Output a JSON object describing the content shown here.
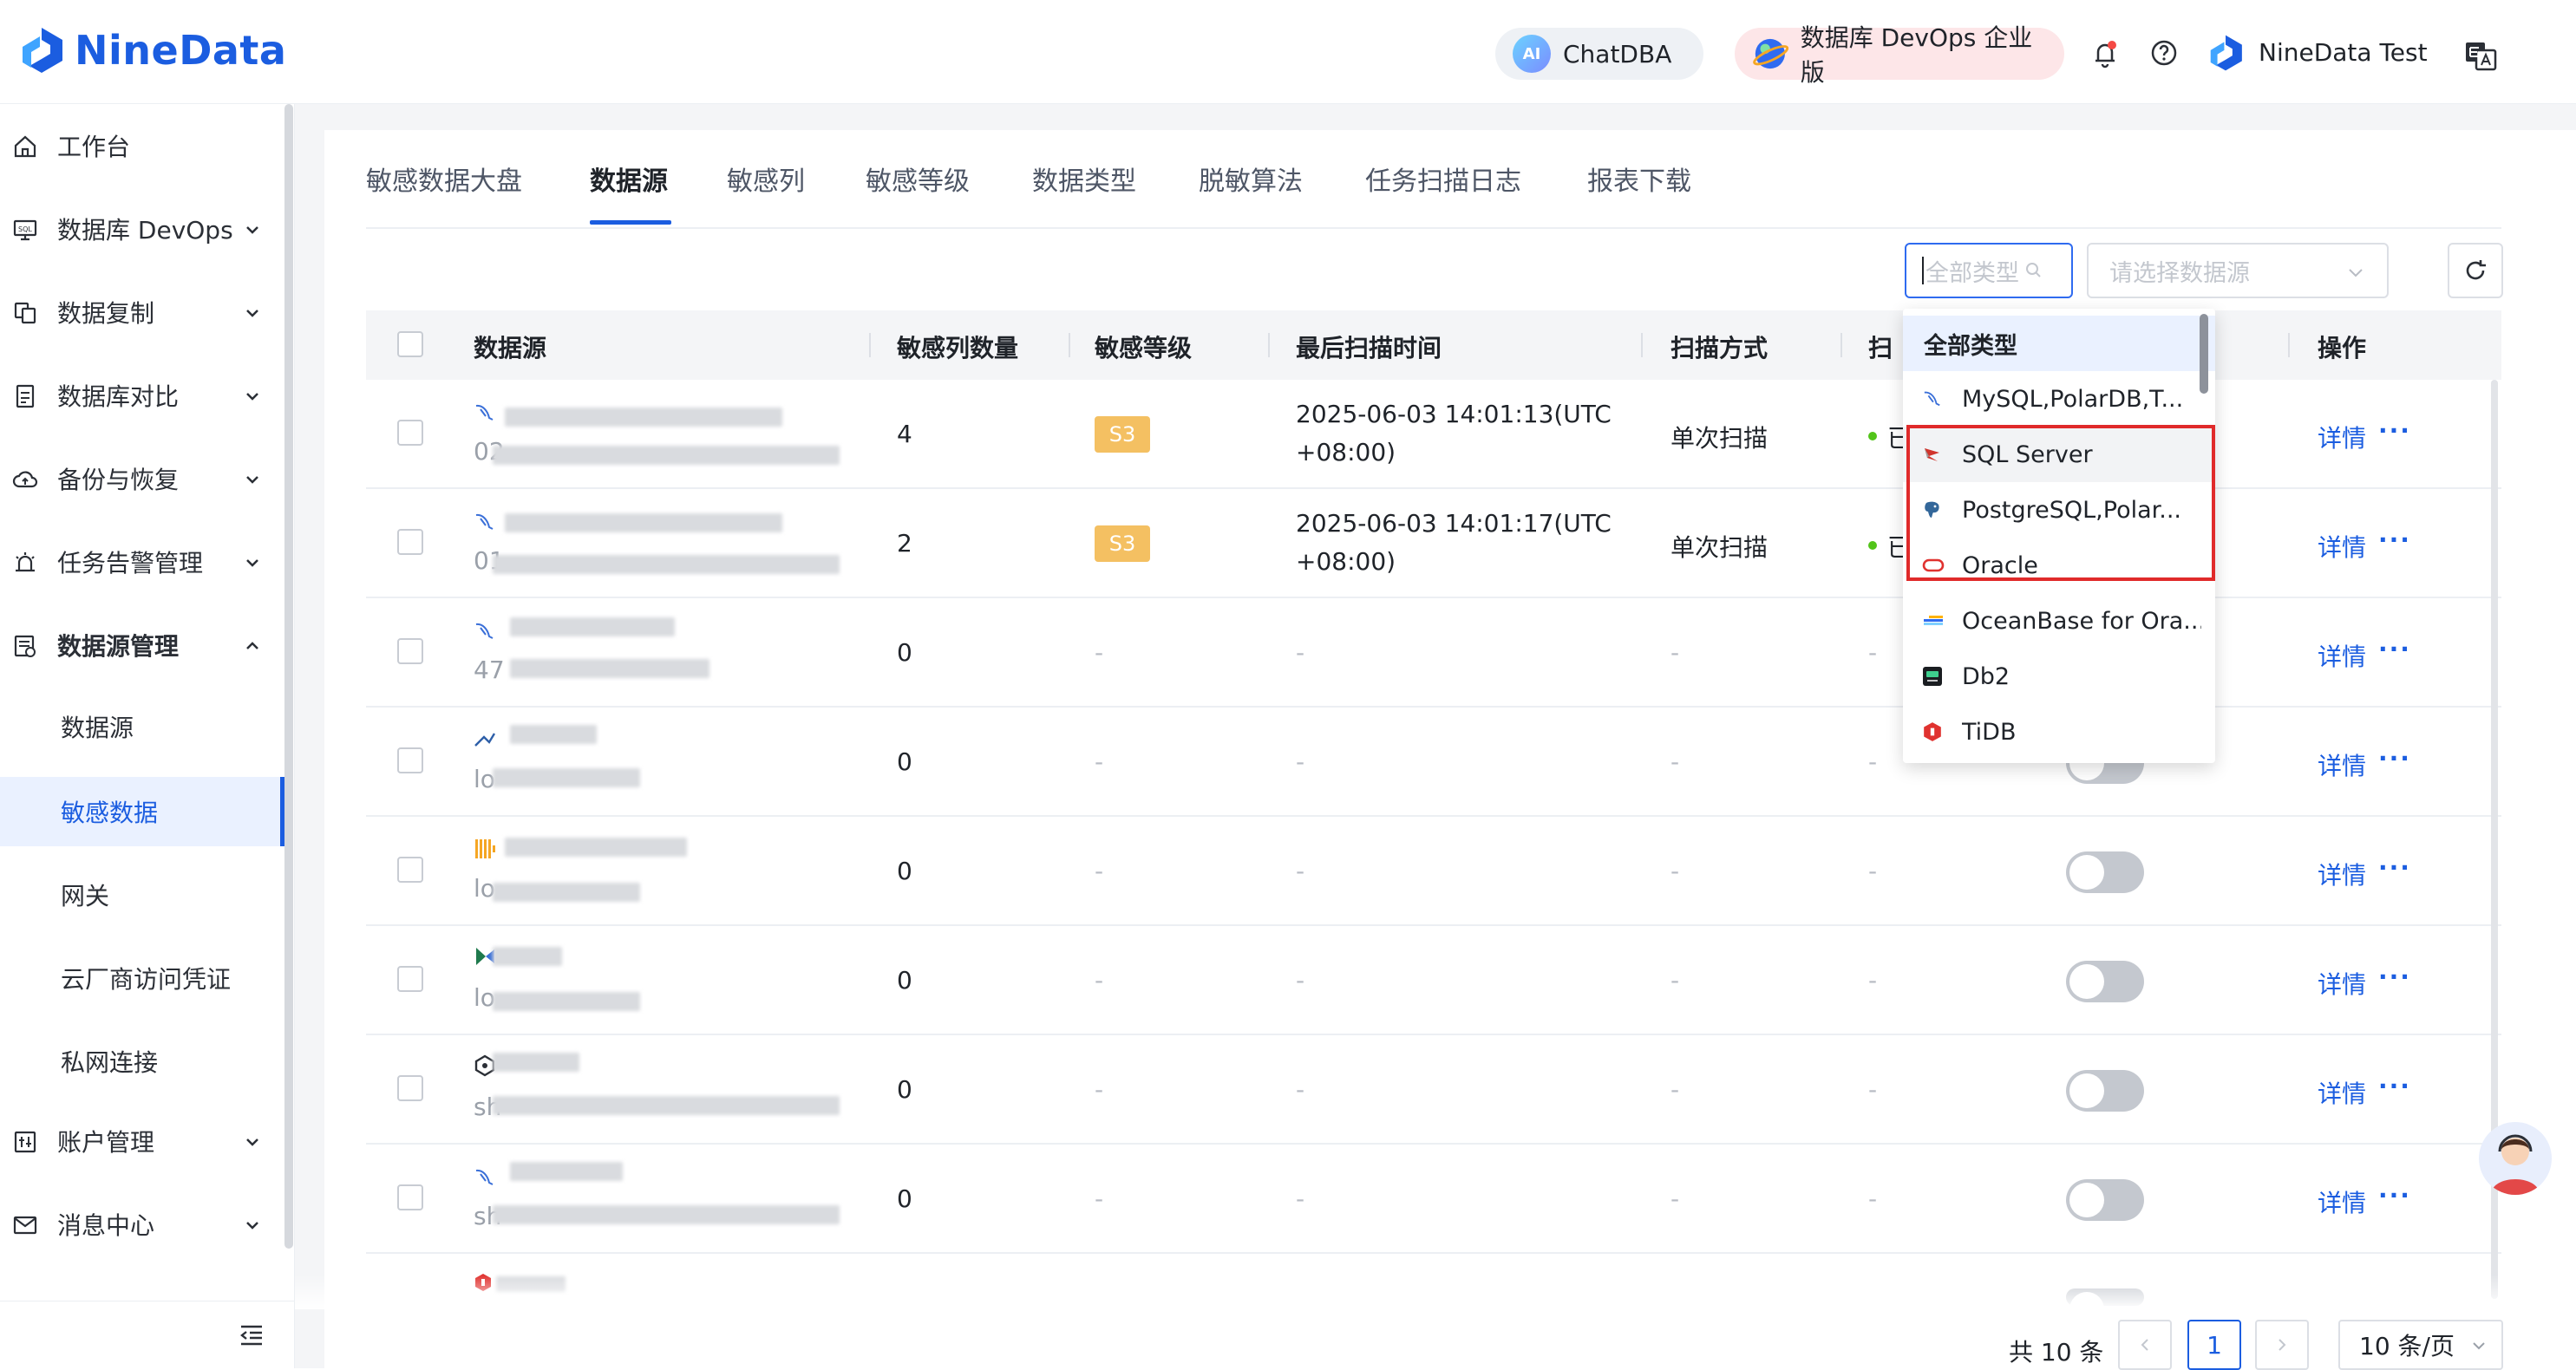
{
  "header": {
    "logo_text": "NineData",
    "chat_label": "ChatDBA",
    "chat_badge": "AI",
    "devops_label": "数据库 DevOps 企业版",
    "user_name": "NineData Test",
    "brand_color": "#1b5de0"
  },
  "sidebar": {
    "items": [
      {
        "label": "工作台",
        "icon": "home-icon",
        "expandable": false
      },
      {
        "label": "数据库 DevOps",
        "icon": "sql-console-icon",
        "expandable": true
      },
      {
        "label": "数据复制",
        "icon": "copy-icon",
        "expandable": true
      },
      {
        "label": "数据库对比",
        "icon": "compare-icon",
        "expandable": true
      },
      {
        "label": "备份与恢复",
        "icon": "cloud-backup-icon",
        "expandable": true
      },
      {
        "label": "任务告警管理",
        "icon": "alarm-icon",
        "expandable": true
      },
      {
        "label": "数据源管理",
        "icon": "datasource-icon",
        "expandable": true,
        "expanded": true
      }
    ],
    "sub_items": [
      {
        "label": "数据源",
        "active": false
      },
      {
        "label": "敏感数据",
        "active": true
      },
      {
        "label": "网关",
        "active": false
      },
      {
        "label": "云厂商访问凭证",
        "active": false
      },
      {
        "label": "私网连接",
        "active": false
      }
    ],
    "items_after": [
      {
        "label": "账户管理",
        "icon": "account-icon",
        "expandable": true
      },
      {
        "label": "消息中心",
        "icon": "mail-icon",
        "expandable": true
      }
    ]
  },
  "tabs": [
    "敏感数据大盘",
    "数据源",
    "敏感列",
    "敏感等级",
    "数据类型",
    "脱敏算法",
    "任务扫描日志",
    "报表下载"
  ],
  "active_tab": "数据源",
  "filters": {
    "type_placeholder": "全部类型",
    "datasource_placeholder": "请选择数据源"
  },
  "table": {
    "columns": [
      "数据源",
      "敏感列数量",
      "敏感等级",
      "最后扫描时间",
      "扫描方式",
      "扫",
      "操作"
    ],
    "rows": [
      {
        "hint": "02",
        "count": "4",
        "level": "S3",
        "time": "2025-06-03 14:01:13(UTC +08:00)",
        "mode": "单次扫描",
        "status": "已",
        "toggle": false,
        "action": "详情",
        "more": "···"
      },
      {
        "hint": "01",
        "count": "2",
        "level": "S3",
        "time": "2025-06-03 14:01:17(UTC +08:00)",
        "mode": "单次扫描",
        "status": "已",
        "toggle": false,
        "action": "详情",
        "more": "···"
      },
      {
        "hint": "47",
        "count": "0",
        "level": "-",
        "time": "-",
        "mode": "-",
        "status": "-",
        "toggle": false,
        "action": "详情",
        "more": "···"
      },
      {
        "hint": "lo",
        "count": "0",
        "level": "-",
        "time": "-",
        "mode": "-",
        "status": "-",
        "toggle": false,
        "action": "详情",
        "more": "···"
      },
      {
        "hint": "lo",
        "count": "0",
        "level": "-",
        "time": "-",
        "mode": "-",
        "status": "-",
        "toggle": false,
        "action": "详情",
        "more": "···"
      },
      {
        "hint": "lo",
        "count": "0",
        "level": "-",
        "time": "-",
        "mode": "-",
        "status": "-",
        "toggle": false,
        "action": "详情",
        "more": "···"
      },
      {
        "hint": "sh",
        "count": "0",
        "level": "-",
        "time": "-",
        "mode": "-",
        "status": "-",
        "toggle": false,
        "action": "详情",
        "more": "···"
      },
      {
        "hint": "sh",
        "count": "0",
        "level": "-",
        "time": "-",
        "mode": "-",
        "status": "-",
        "toggle": false,
        "action": "详情",
        "more": "···"
      }
    ]
  },
  "dropdown": {
    "items": [
      {
        "label": "全部类型",
        "icon": "none",
        "selected": true
      },
      {
        "label": "MySQL,PolarDB,T...",
        "icon": "mysql-dolphin-icon"
      },
      {
        "label": "SQL Server",
        "icon": "sqlserver-icon",
        "hovered": true
      },
      {
        "label": "PostgreSQL,Polar...",
        "icon": "postgresql-elephant-icon"
      },
      {
        "label": "Oracle",
        "icon": "oracle-icon"
      },
      {
        "label": "OceanBase for Ora...",
        "icon": "oceanbase-icon"
      },
      {
        "label": "Db2",
        "icon": "db2-icon"
      },
      {
        "label": "TiDB",
        "icon": "tidb-icon"
      }
    ],
    "highlight_color": "#e02a2a"
  },
  "pagination": {
    "total": "共 10 条",
    "current_page": "1",
    "page_size": "10 条/页"
  }
}
